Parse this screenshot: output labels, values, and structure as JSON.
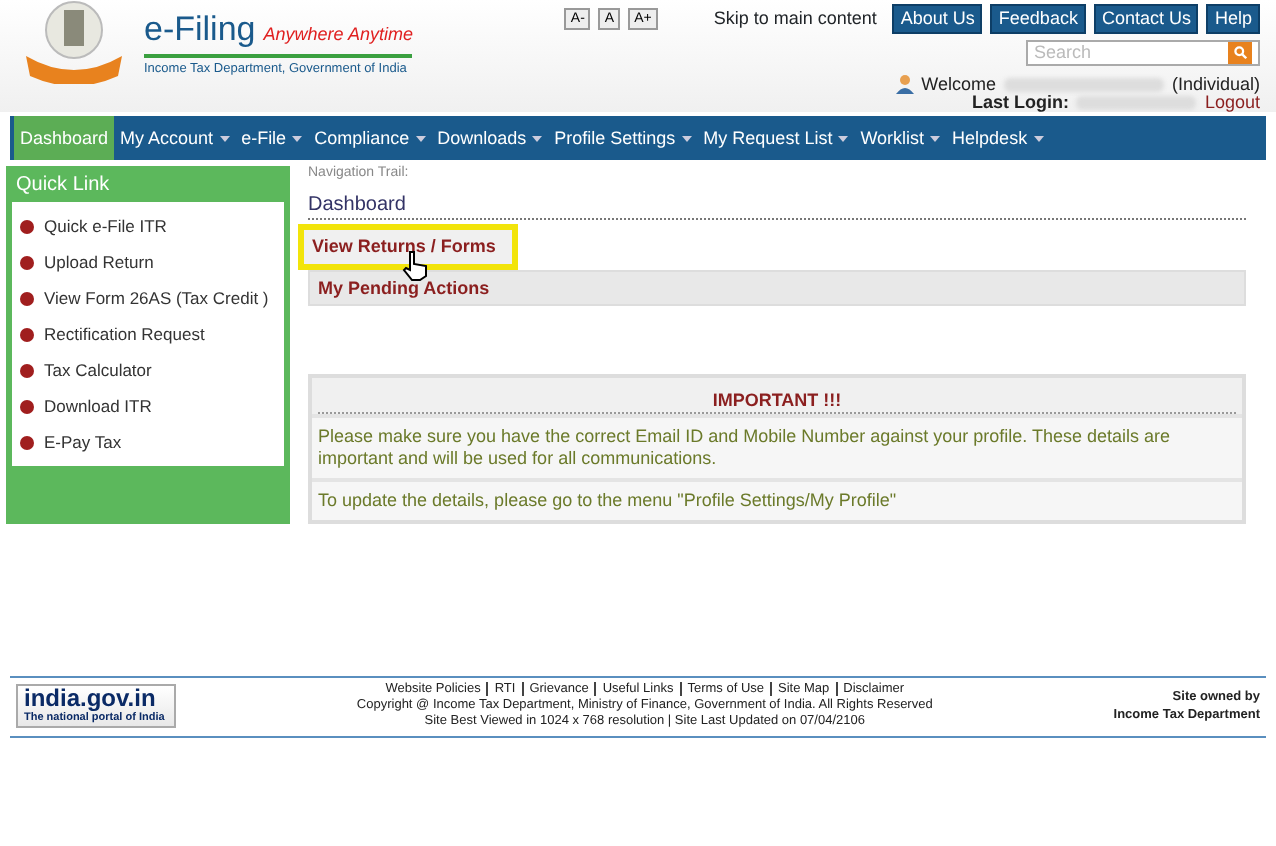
{
  "header": {
    "title": "e-Filing",
    "tagline": "Anywhere Anytime",
    "subtitle": "Income Tax Department, Government of India",
    "font_sizes": [
      "A-",
      "A",
      "A+"
    ],
    "skip_link": "Skip to main content",
    "top_buttons": [
      "About Us",
      "Feedback",
      "Contact Us",
      "Help"
    ],
    "search": {
      "placeholder": "Search"
    },
    "welcome": "Welcome",
    "user_type": "(Individual)",
    "last_login_label": "Last Login:",
    "logout": "Logout"
  },
  "menu": [
    {
      "label": "Dashboard",
      "selected": true,
      "dropdown": false
    },
    {
      "label": "My Account",
      "selected": false,
      "dropdown": true
    },
    {
      "label": "e-File",
      "selected": false,
      "dropdown": true
    },
    {
      "label": "Compliance",
      "selected": false,
      "dropdown": true
    },
    {
      "label": "Downloads",
      "selected": false,
      "dropdown": true
    },
    {
      "label": "Profile Settings",
      "selected": false,
      "dropdown": true
    },
    {
      "label": "My Request List",
      "selected": false,
      "dropdown": true
    },
    {
      "label": "Worklist",
      "selected": false,
      "dropdown": true
    },
    {
      "label": "Helpdesk",
      "selected": false,
      "dropdown": true
    }
  ],
  "quick_link": {
    "title": "Quick Link",
    "items": [
      "Quick e-File ITR",
      "Upload Return",
      "View Form 26AS (Tax Credit )",
      "Rectification Request",
      "Tax Calculator",
      "Download ITR",
      "E-Pay Tax"
    ]
  },
  "navigation_trail": "Navigation Trail:",
  "page_title": "Dashboard",
  "sections": [
    {
      "label": "View Returns / Forms",
      "highlighted": true
    },
    {
      "label": "My Pending Actions",
      "highlighted": false
    }
  ],
  "notice": {
    "title": "IMPORTANT !!!",
    "paragraphs": [
      "Please make sure you have the correct Email ID and Mobile Number against your profile. These details are important and will be used for all communications.",
      "To update the details, please go to the menu \"Profile Settings/My Profile\""
    ]
  },
  "footer": {
    "portal_logo": "india.gov.in",
    "portal_caption": "The national portal of India",
    "links": [
      "Website Policies",
      "RTI",
      "Grievance",
      "Useful Links",
      "Terms of Use",
      "Site Map",
      "Disclaimer"
    ],
    "copyright": "Copyright @ Income Tax Department, Ministry of Finance, Government of India. All Rights Reserved",
    "best_viewed": "Site Best Viewed in 1024 x 768 resolution | Site Last Updated on 07/04/2106",
    "owner_label": "Site owned by",
    "owner": "Income Tax Department"
  }
}
